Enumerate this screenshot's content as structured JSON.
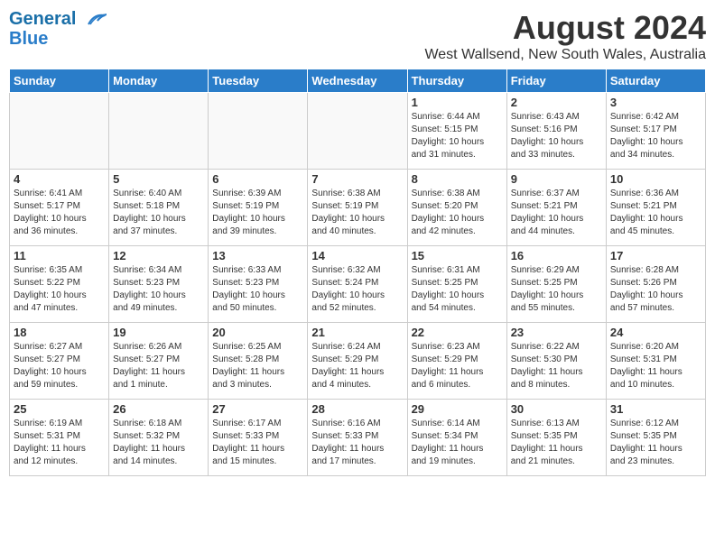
{
  "logo": {
    "line1": "General",
    "line2": "Blue"
  },
  "title": "August 2024",
  "subtitle": "West Wallsend, New South Wales, Australia",
  "days_of_week": [
    "Sunday",
    "Monday",
    "Tuesday",
    "Wednesday",
    "Thursday",
    "Friday",
    "Saturday"
  ],
  "weeks": [
    [
      {
        "day": "",
        "info": ""
      },
      {
        "day": "",
        "info": ""
      },
      {
        "day": "",
        "info": ""
      },
      {
        "day": "",
        "info": ""
      },
      {
        "day": "1",
        "info": "Sunrise: 6:44 AM\nSunset: 5:15 PM\nDaylight: 10 hours\nand 31 minutes."
      },
      {
        "day": "2",
        "info": "Sunrise: 6:43 AM\nSunset: 5:16 PM\nDaylight: 10 hours\nand 33 minutes."
      },
      {
        "day": "3",
        "info": "Sunrise: 6:42 AM\nSunset: 5:17 PM\nDaylight: 10 hours\nand 34 minutes."
      }
    ],
    [
      {
        "day": "4",
        "info": "Sunrise: 6:41 AM\nSunset: 5:17 PM\nDaylight: 10 hours\nand 36 minutes."
      },
      {
        "day": "5",
        "info": "Sunrise: 6:40 AM\nSunset: 5:18 PM\nDaylight: 10 hours\nand 37 minutes."
      },
      {
        "day": "6",
        "info": "Sunrise: 6:39 AM\nSunset: 5:19 PM\nDaylight: 10 hours\nand 39 minutes."
      },
      {
        "day": "7",
        "info": "Sunrise: 6:38 AM\nSunset: 5:19 PM\nDaylight: 10 hours\nand 40 minutes."
      },
      {
        "day": "8",
        "info": "Sunrise: 6:38 AM\nSunset: 5:20 PM\nDaylight: 10 hours\nand 42 minutes."
      },
      {
        "day": "9",
        "info": "Sunrise: 6:37 AM\nSunset: 5:21 PM\nDaylight: 10 hours\nand 44 minutes."
      },
      {
        "day": "10",
        "info": "Sunrise: 6:36 AM\nSunset: 5:21 PM\nDaylight: 10 hours\nand 45 minutes."
      }
    ],
    [
      {
        "day": "11",
        "info": "Sunrise: 6:35 AM\nSunset: 5:22 PM\nDaylight: 10 hours\nand 47 minutes."
      },
      {
        "day": "12",
        "info": "Sunrise: 6:34 AM\nSunset: 5:23 PM\nDaylight: 10 hours\nand 49 minutes."
      },
      {
        "day": "13",
        "info": "Sunrise: 6:33 AM\nSunset: 5:23 PM\nDaylight: 10 hours\nand 50 minutes."
      },
      {
        "day": "14",
        "info": "Sunrise: 6:32 AM\nSunset: 5:24 PM\nDaylight: 10 hours\nand 52 minutes."
      },
      {
        "day": "15",
        "info": "Sunrise: 6:31 AM\nSunset: 5:25 PM\nDaylight: 10 hours\nand 54 minutes."
      },
      {
        "day": "16",
        "info": "Sunrise: 6:29 AM\nSunset: 5:25 PM\nDaylight: 10 hours\nand 55 minutes."
      },
      {
        "day": "17",
        "info": "Sunrise: 6:28 AM\nSunset: 5:26 PM\nDaylight: 10 hours\nand 57 minutes."
      }
    ],
    [
      {
        "day": "18",
        "info": "Sunrise: 6:27 AM\nSunset: 5:27 PM\nDaylight: 10 hours\nand 59 minutes."
      },
      {
        "day": "19",
        "info": "Sunrise: 6:26 AM\nSunset: 5:27 PM\nDaylight: 11 hours\nand 1 minute."
      },
      {
        "day": "20",
        "info": "Sunrise: 6:25 AM\nSunset: 5:28 PM\nDaylight: 11 hours\nand 3 minutes."
      },
      {
        "day": "21",
        "info": "Sunrise: 6:24 AM\nSunset: 5:29 PM\nDaylight: 11 hours\nand 4 minutes."
      },
      {
        "day": "22",
        "info": "Sunrise: 6:23 AM\nSunset: 5:29 PM\nDaylight: 11 hours\nand 6 minutes."
      },
      {
        "day": "23",
        "info": "Sunrise: 6:22 AM\nSunset: 5:30 PM\nDaylight: 11 hours\nand 8 minutes."
      },
      {
        "day": "24",
        "info": "Sunrise: 6:20 AM\nSunset: 5:31 PM\nDaylight: 11 hours\nand 10 minutes."
      }
    ],
    [
      {
        "day": "25",
        "info": "Sunrise: 6:19 AM\nSunset: 5:31 PM\nDaylight: 11 hours\nand 12 minutes."
      },
      {
        "day": "26",
        "info": "Sunrise: 6:18 AM\nSunset: 5:32 PM\nDaylight: 11 hours\nand 14 minutes."
      },
      {
        "day": "27",
        "info": "Sunrise: 6:17 AM\nSunset: 5:33 PM\nDaylight: 11 hours\nand 15 minutes."
      },
      {
        "day": "28",
        "info": "Sunrise: 6:16 AM\nSunset: 5:33 PM\nDaylight: 11 hours\nand 17 minutes."
      },
      {
        "day": "29",
        "info": "Sunrise: 6:14 AM\nSunset: 5:34 PM\nDaylight: 11 hours\nand 19 minutes."
      },
      {
        "day": "30",
        "info": "Sunrise: 6:13 AM\nSunset: 5:35 PM\nDaylight: 11 hours\nand 21 minutes."
      },
      {
        "day": "31",
        "info": "Sunrise: 6:12 AM\nSunset: 5:35 PM\nDaylight: 11 hours\nand 23 minutes."
      }
    ]
  ]
}
